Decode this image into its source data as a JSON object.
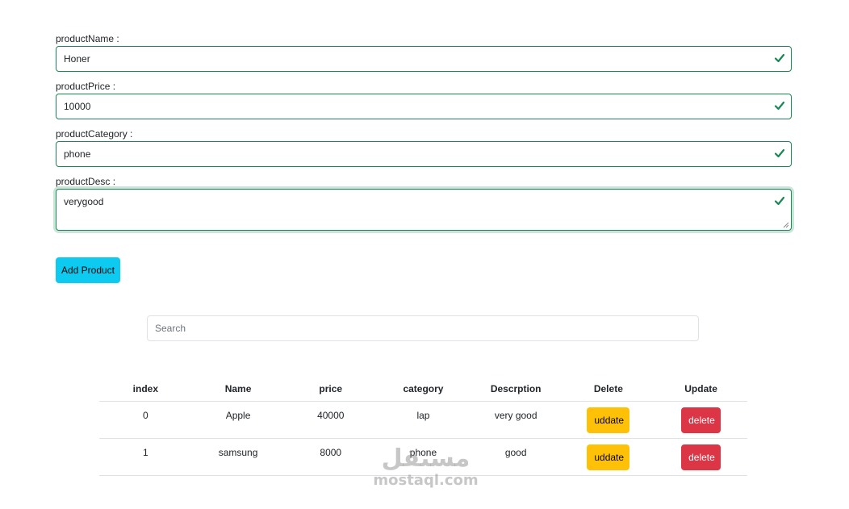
{
  "form": {
    "fields": [
      {
        "label": "productName :",
        "value": "Honer"
      },
      {
        "label": "productPrice :",
        "value": "10000"
      },
      {
        "label": "productCategory :",
        "value": "phone"
      },
      {
        "label": "productDesc :",
        "value": "verygood"
      }
    ],
    "submit_label": "Add Product",
    "valid_color": "#198754",
    "valid_icon": "check-icon"
  },
  "search": {
    "placeholder": "Search"
  },
  "table": {
    "headers": [
      "index",
      "Name",
      "price",
      "category",
      "Descrption",
      "Delete",
      "Update"
    ],
    "rows": [
      {
        "index": "0",
        "name": "Apple",
        "price": "40000",
        "category": "lap",
        "description": "very good",
        "update_label": "uddate",
        "delete_label": "delete"
      },
      {
        "index": "1",
        "name": "samsung",
        "price": "8000",
        "category": "phone",
        "description": "good",
        "update_label": "uddate",
        "delete_label": "delete"
      }
    ]
  },
  "colors": {
    "info": "#0dcaf0",
    "warning": "#ffc107",
    "danger": "#dc3545"
  },
  "watermark": {
    "arabic": "مستقل",
    "latin": "mostaql.com"
  }
}
